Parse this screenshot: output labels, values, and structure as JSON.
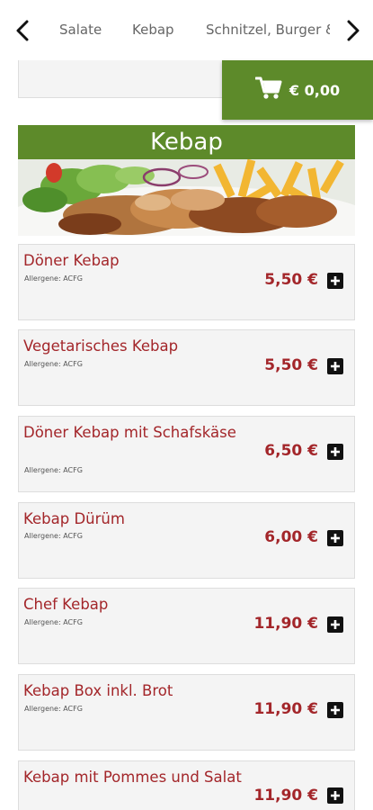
{
  "nav": {
    "tabs": [
      {
        "label": "Salate"
      },
      {
        "label": "Kebap"
      },
      {
        "label": "Schnitzel, Burger & Co"
      }
    ]
  },
  "cart": {
    "total": "€ 0,00",
    "icon": "cart-icon"
  },
  "category": {
    "title": "Kebap"
  },
  "items": [
    {
      "name": "Döner Kebap",
      "allergens": "Allergene: ACFG",
      "price": "5,50 €"
    },
    {
      "name": "Vegetarisches Kebap",
      "allergens": "Allergene: ACFG",
      "price": "5,50 €"
    },
    {
      "name": "Döner Kebap mit Schafskäse",
      "allergens": "Allergene: ACFG",
      "price": "6,50 €"
    },
    {
      "name": "Kebap Dürüm",
      "allergens": "Allergene: ACFG",
      "price": "6,00 €"
    },
    {
      "name": "Chef Kebap",
      "allergens": "Allergene: ACFG",
      "price": "11,90 €"
    },
    {
      "name": "Kebap Box inkl. Brot",
      "allergens": "Allergene: ACFG",
      "price": "11,90 €"
    },
    {
      "name": "Kebap mit Pommes und Salat",
      "allergens": "",
      "price": "11,90 €"
    }
  ],
  "colors": {
    "brand_green": "#5d8a2a",
    "price_red": "#a3262a"
  }
}
